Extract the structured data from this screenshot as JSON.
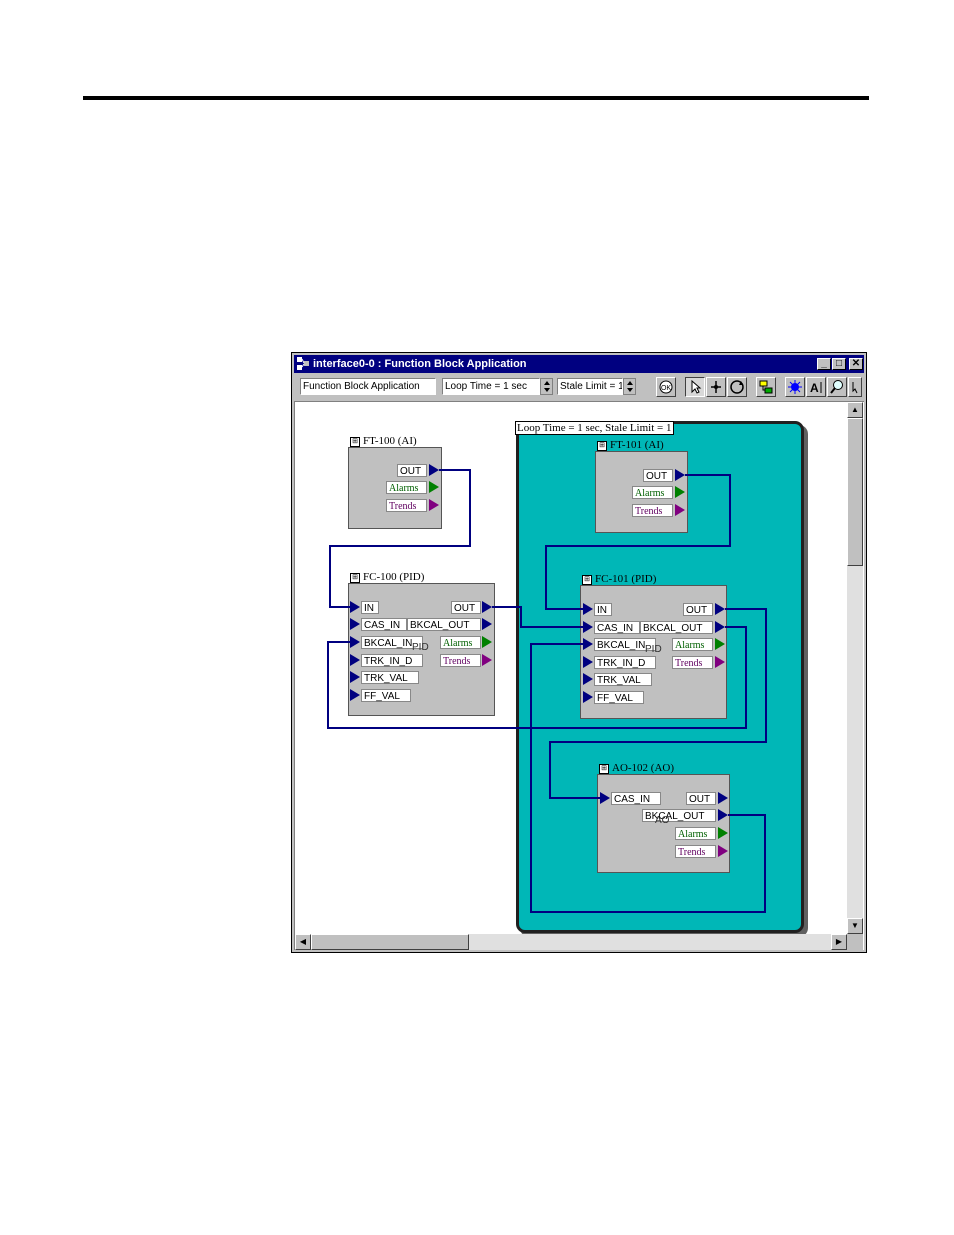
{
  "window": {
    "title": "interface0-0 : Function Block Application",
    "minimize": "_",
    "maximize": "□",
    "close": "✕"
  },
  "toolbar": {
    "app_field": "Function Block Application",
    "loop_time": "Loop Time = 1 sec",
    "stale_limit": "Stale Limit = 1",
    "tools": [
      "ok-icon",
      "pointer-icon",
      "link-icon",
      "loop-icon",
      "download-icon",
      "debug-icon",
      "ai-icon",
      "zoom-icon",
      "help-icon"
    ]
  },
  "loop_label": "Loop Time = 1 sec, Stale Limit = 1",
  "blocks": {
    "ft100": {
      "title": "FT-100 (AI)",
      "out": "OUT",
      "alarms": "Alarms",
      "trends": "Trends"
    },
    "fc100": {
      "title": "FC-100 (PID)",
      "in": "IN",
      "cas_in": "CAS_IN",
      "bkcal_in": "BKCAL_IN",
      "trk_in_d": "TRK_IN_D",
      "trk_val": "TRK_VAL",
      "ff_val": "FF_VAL",
      "out": "OUT",
      "bkcal_out": "BKCAL_OUT",
      "alarms": "Alarms",
      "trends": "Trends",
      "faint": "PID"
    },
    "ft101": {
      "title": "FT-101 (AI)",
      "out": "OUT",
      "alarms": "Alarms",
      "trends": "Trends"
    },
    "fc101": {
      "title": "FC-101 (PID)",
      "in": "IN",
      "cas_in": "CAS_IN",
      "bkcal_in": "BKCAL_IN",
      "trk_in_d": "TRK_IN_D",
      "trk_val": "TRK_VAL",
      "ff_val": "FF_VAL",
      "out": "OUT",
      "bkcal_out": "BKCAL_OUT",
      "alarms": "Alarms",
      "trends": "Trends",
      "faint": "PID"
    },
    "ao102": {
      "title": "AO-102 (AO)",
      "cas_in": "CAS_IN",
      "out": "OUT",
      "bkcal_out": "BKCAL_OUT",
      "alarms": "Alarms",
      "trends": "Trends",
      "faint": "AO"
    }
  },
  "colors": {
    "titlebar": "#000080",
    "loop_fill": "#00b7b7",
    "wire": "#000080",
    "block": "#c0c0c0"
  }
}
